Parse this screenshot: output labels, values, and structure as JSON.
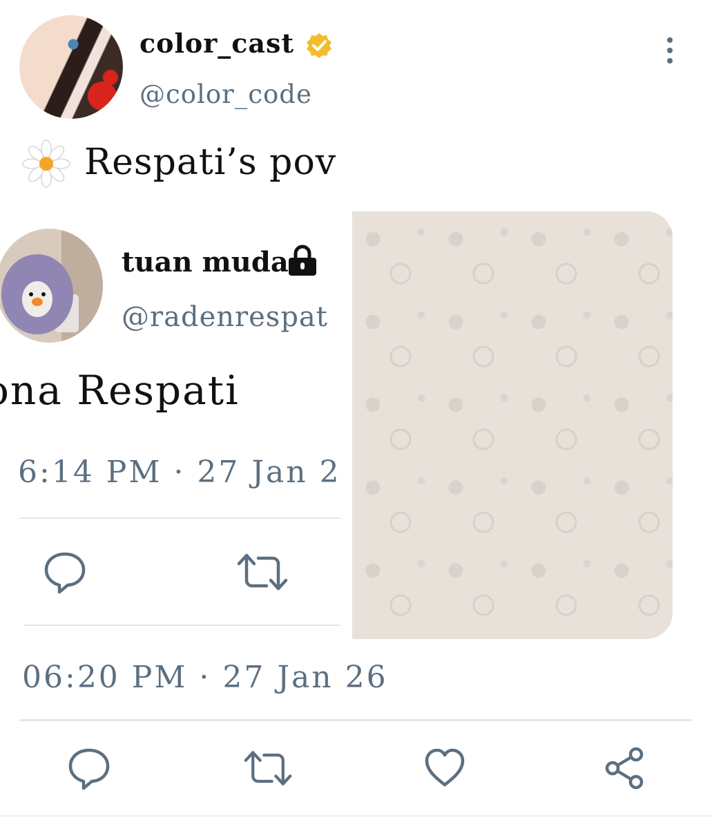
{
  "post": {
    "author_name": "color_cast",
    "author_handle": "@color_code",
    "text": "Respati’s pov",
    "timestamp": "06:20 PM · 27 Jan 26",
    "verified": true
  },
  "embedded": {
    "author_name": "tuan muda",
    "author_handle": "@radenrespat",
    "text": "ona Respati",
    "timestamp": "6:14 PM · 27 Jan 2",
    "locked": true
  },
  "icons": {
    "more": "more-vertical-icon",
    "daisy": "daisy-icon",
    "verified": "verified-badge-icon",
    "lock": "lock-icon",
    "reply": "reply-icon",
    "retweet": "retweet-icon",
    "like": "heart-icon",
    "share": "share-icon"
  },
  "colors": {
    "muted": "#5b6f80",
    "verified": "#f4bb2b",
    "wallpaper": "#e8e1da",
    "divider": "#e3e6e9"
  }
}
